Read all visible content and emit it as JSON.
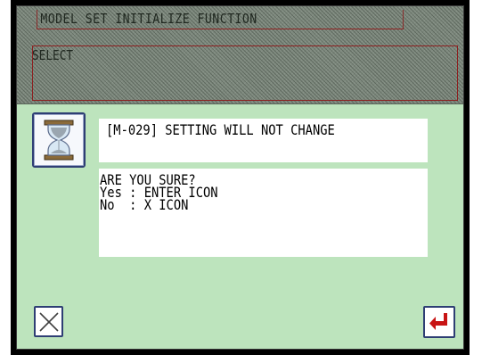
{
  "header": {
    "title": "MODEL SET INITIALIZE FUNCTION"
  },
  "select": {
    "label": "SELECT"
  },
  "dialog": {
    "icon": "hourglass-icon",
    "message": "[M-029] SETTING WILL NOT CHANGE",
    "confirm_lines": [
      "ARE YOU SURE?",
      "Yes : ENTER ICON",
      "No  : X ICON"
    ]
  },
  "buttons": {
    "cancel_icon": "close-x-icon",
    "enter_icon": "enter-return-icon"
  },
  "colors": {
    "panel_bg": "#bde4bd",
    "hatched_area": "#7e897e",
    "box_border": "#8c2020",
    "button_border": "#2e3e74",
    "enter_arrow": "#c81414"
  }
}
